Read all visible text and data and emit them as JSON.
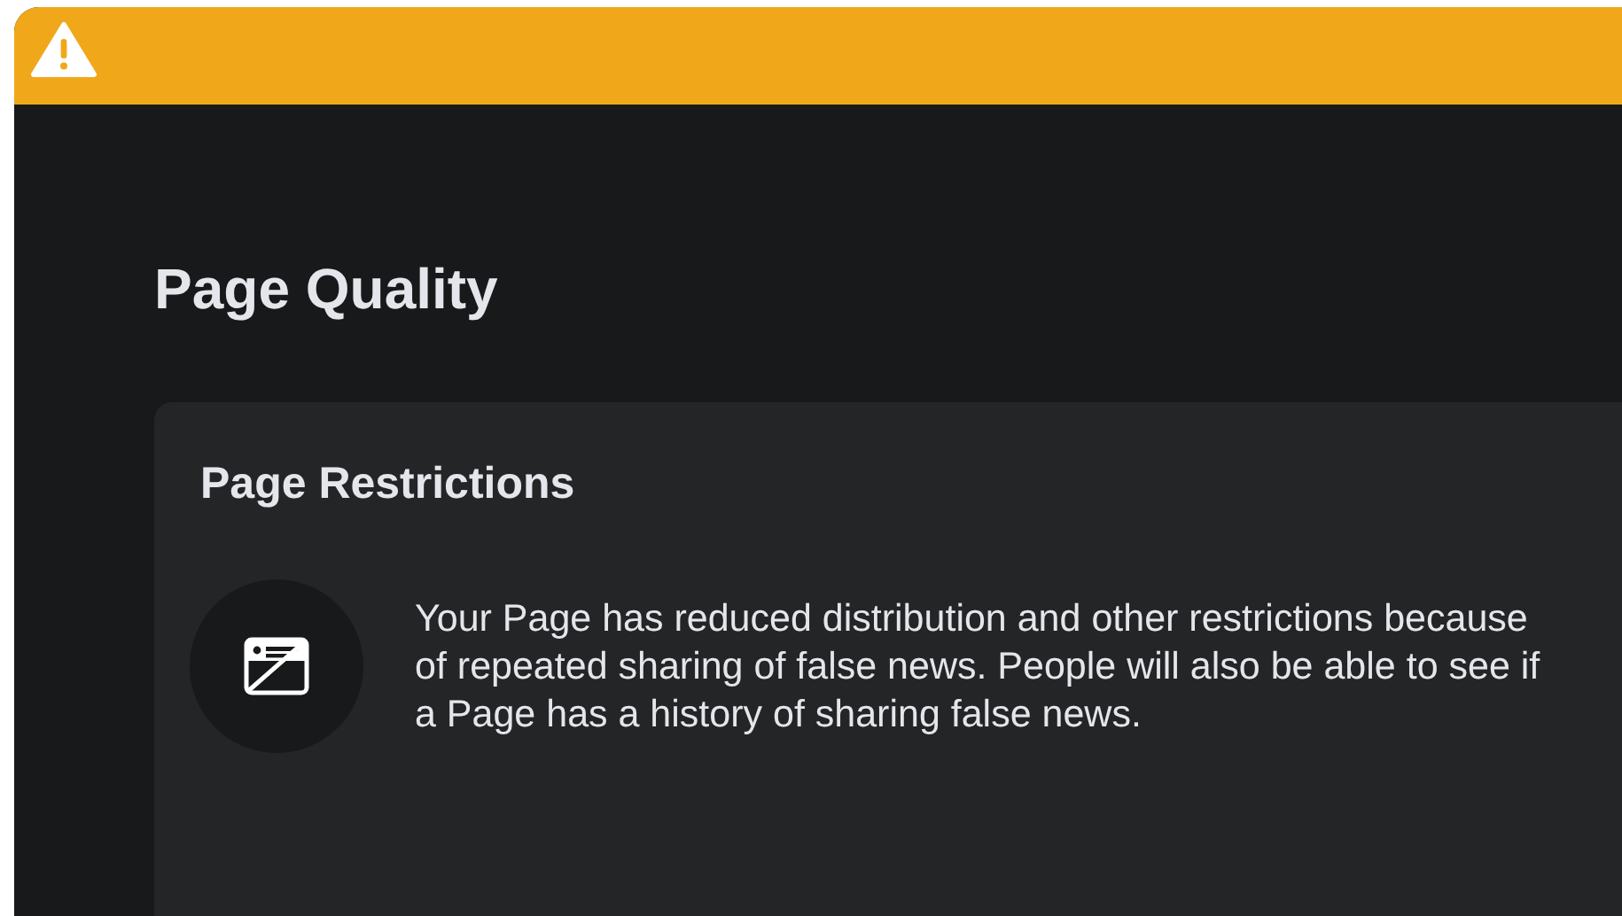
{
  "banner": {
    "kind": "warning"
  },
  "title": "Page Quality",
  "panel": {
    "heading": "Page Restrictions",
    "message": "Your Page has reduced distribution and other restrictions because of repeated sharing of false news. People will also be able to see if a Page has a history of sharing false news."
  }
}
